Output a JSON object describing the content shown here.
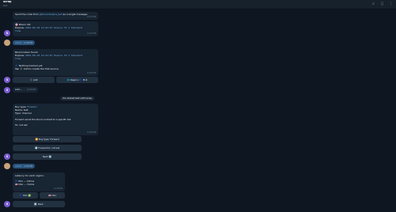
{
  "header": {
    "title": "scrap",
    "subtitle": "bot"
  },
  "messages": {
    "m1": {
      "text_before": "Send the code from ",
      "link": "@bloomSolana_bot",
      "text_after": " as a single message:",
      "time": "12:57 PM"
    },
    "m2": {
      "title": "🌸 Bloom OK",
      "expires_label": "Expires: ",
      "expires_value": "2024-09-18 12:21:07 Russia TZ 2 Standard",
      "expires_tail": "Time",
      "time": "12:57 PM"
    },
    "user1": {
      "text": "/start",
      "time": "12:58 PM"
    },
    "m3": {
      "title": "Bloom token found.",
      "expires_label": "Expires: ",
      "expires_value": "2024-09-18 12:21:07 Russia TZ 2 Standard",
      "expires_tail": "Time",
      "empty_title": "💤 Nothing tracked yet",
      "empty_hint": "Tap ➕ Add to create the first source.",
      "time": "12:58 PM",
      "buttons": {
        "add": "➕ Add",
        "region": "🌐 Region: 🇪🇺 EU1"
      }
    },
    "m4": {
      "text": "Add...",
      "time": "12:59 PM"
    },
    "service": {
      "text": "You shared text with scrap"
    },
    "m5": {
      "buy_type_label": "Buy type: ",
      "buy_type_value": "Forward",
      "name_line": "Name: test",
      "type_line": "Type: channel",
      "note": "Forward sends the found contract to a specific bot",
      "to_line": "To: not set",
      "time": "12:59 PM",
      "buttons": {
        "buy_type": "🔀 Buy type: Forward",
        "forward_to": "↩️ Forward to: not set",
        "next": "Next ➡️"
      }
    },
    "user2": {
      "text": "/start",
      "time": "12:59 PM"
    },
    "m6": {
      "title": "Latency for each region:",
      "eu1": "🇪🇺 EU1 — 145ms",
      "usa": "🇺🇸 USA — 712ms",
      "time": "12:59 PM",
      "buttons": {
        "eu1": "🇪🇺 EU1 ✅",
        "us1": "🇺🇸 US1",
        "back": "🔙 Back"
      }
    }
  },
  "avatars": {
    "bot_initial": "S"
  },
  "icons": {
    "search": "search-icon",
    "sidebar": "sidebar-icon",
    "menu": "more-icon"
  },
  "colors": {
    "background": "#0e1621",
    "bubble_in": "#182533",
    "bubble_out": "#2b5278",
    "accent": "#6ab3f3",
    "avatar": "#7a5cd1"
  }
}
